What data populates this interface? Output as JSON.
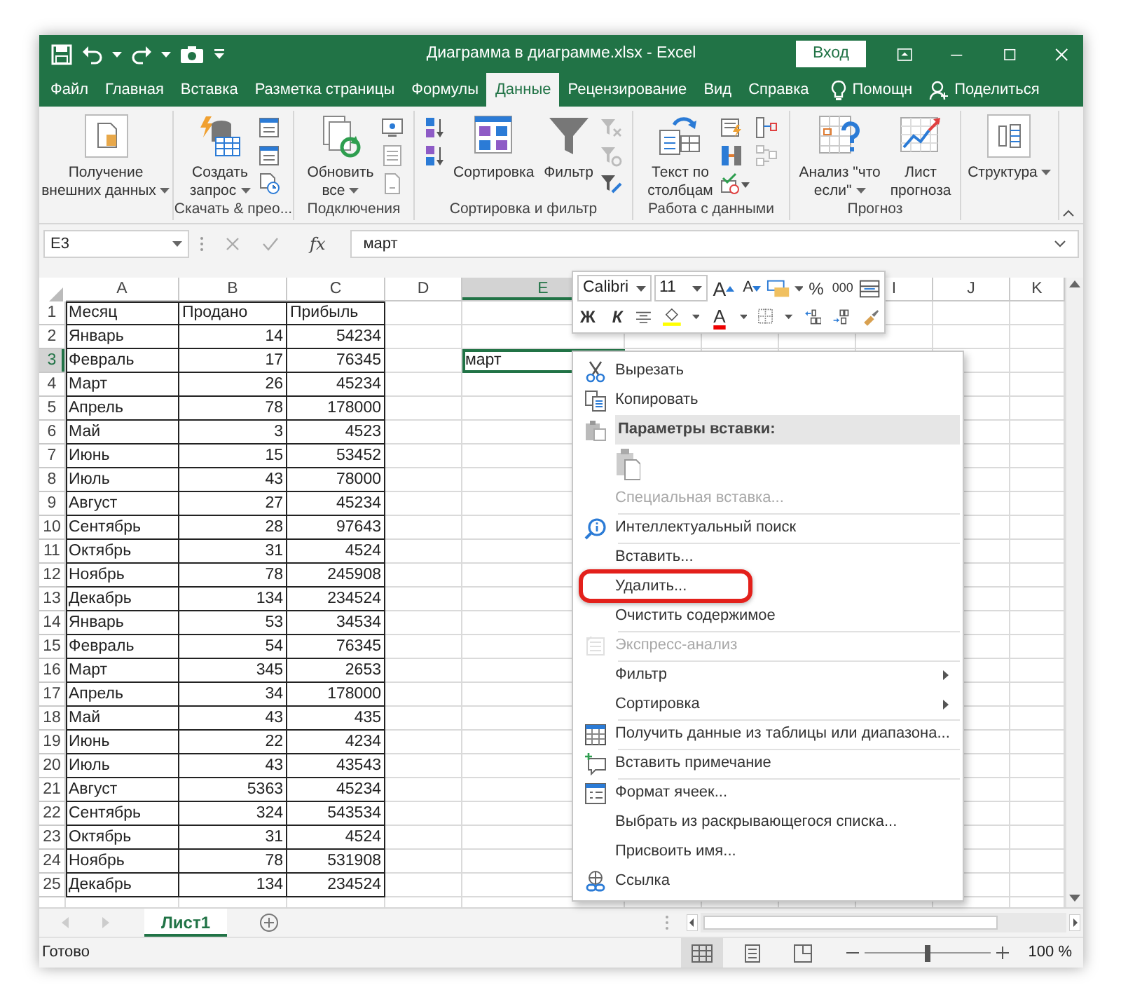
{
  "window": {
    "title": "Диаграмма в диаграмме.xlsx  -  Excel",
    "sign_in": "Вход"
  },
  "tabs": [
    {
      "label": "Файл",
      "selected": false
    },
    {
      "label": "Главная",
      "selected": false
    },
    {
      "label": "Вставка",
      "selected": false
    },
    {
      "label": "Разметка страницы",
      "selected": false
    },
    {
      "label": "Формулы",
      "selected": false
    },
    {
      "label": "Данные",
      "selected": true
    },
    {
      "label": "Рецензирование",
      "selected": false
    },
    {
      "label": "Вид",
      "selected": false
    },
    {
      "label": "Справка",
      "selected": false
    }
  ],
  "tell_me": "Помощн",
  "share": "Поделиться",
  "ribbon_groups": [
    {
      "buttons": [
        {
          "label": "Получение\nвнешних данных",
          "dropdown": true
        }
      ]
    },
    {
      "label": "Скачать & прео...",
      "buttons": [
        {
          "label": "Создать\nзапрос",
          "dropdown": true
        }
      ]
    },
    {
      "label": "Подключения",
      "buttons": [
        {
          "label": "Обновить\nвсе",
          "dropdown": true
        }
      ]
    },
    {
      "label": "Сортировка и фильтр",
      "buttons": [
        {
          "label": "Сортировка",
          "dropdown": false
        },
        {
          "label": "Фильтр",
          "dropdown": false
        }
      ]
    },
    {
      "label": "Работа с данными",
      "buttons": [
        {
          "label": "Текст по\nстолбцам",
          "dropdown": false
        }
      ]
    },
    {
      "label": "Прогноз",
      "buttons": [
        {
          "label": "Анализ \"что\nесли\"",
          "dropdown": true
        },
        {
          "label": "Лист\nпрогноза",
          "dropdown": false
        }
      ]
    },
    {
      "buttons": [
        {
          "label": "Структура",
          "dropdown": true
        }
      ]
    }
  ],
  "formula_bar": {
    "name_box": "E3",
    "function_label": "fx",
    "value": "март"
  },
  "sheet": {
    "columns": [
      {
        "label": "A",
        "selected": false
      },
      {
        "label": "B",
        "selected": false
      },
      {
        "label": "C",
        "selected": false
      },
      {
        "label": "D",
        "selected": false
      },
      {
        "label": "E",
        "selected": true
      },
      {
        "label": "I",
        "selected": false
      },
      {
        "label": "J",
        "selected": false
      },
      {
        "label": "K",
        "selected": false
      }
    ],
    "rows": [
      {
        "number": "1",
        "selected": false,
        "cells": [
          "Месяц",
          "Продано",
          "Прибыль"
        ]
      },
      {
        "number": "2",
        "selected": false,
        "cells": [
          "Январь",
          "14",
          "54234"
        ]
      },
      {
        "number": "3",
        "selected": true,
        "cells": [
          "Февраль",
          "17",
          "76345"
        ],
        "column_e": "март"
      },
      {
        "number": "4",
        "selected": false,
        "cells": [
          "Март",
          "26",
          "45234"
        ]
      },
      {
        "number": "5",
        "selected": false,
        "cells": [
          "Апрель",
          "78",
          "178000"
        ]
      },
      {
        "number": "6",
        "selected": false,
        "cells": [
          "Май",
          "3",
          "4523"
        ]
      },
      {
        "number": "7",
        "selected": false,
        "cells": [
          "Июнь",
          "15",
          "53452"
        ]
      },
      {
        "number": "8",
        "selected": false,
        "cells": [
          "Июль",
          "43",
          "78000"
        ]
      },
      {
        "number": "9",
        "selected": false,
        "cells": [
          "Август",
          "27",
          "45234"
        ]
      },
      {
        "number": "10",
        "selected": false,
        "cells": [
          "Сентябрь",
          "28",
          "97643"
        ]
      },
      {
        "number": "11",
        "selected": false,
        "cells": [
          "Октябрь",
          "31",
          "4524"
        ]
      },
      {
        "number": "12",
        "selected": false,
        "cells": [
          "Ноябрь",
          "78",
          "245908"
        ]
      },
      {
        "number": "13",
        "selected": false,
        "cells": [
          "Декабрь",
          "134",
          "234524"
        ]
      },
      {
        "number": "14",
        "selected": false,
        "cells": [
          "Январь",
          "53",
          "34534"
        ]
      },
      {
        "number": "15",
        "selected": false,
        "cells": [
          "Февраль",
          "54",
          "76345"
        ]
      },
      {
        "number": "16",
        "selected": false,
        "cells": [
          "Март",
          "345",
          "2653"
        ]
      },
      {
        "number": "17",
        "selected": false,
        "cells": [
          "Апрель",
          "34",
          "178000"
        ]
      },
      {
        "number": "18",
        "selected": false,
        "cells": [
          "Май",
          "43",
          "435"
        ]
      },
      {
        "number": "19",
        "selected": false,
        "cells": [
          "Июнь",
          "22",
          "4234"
        ]
      },
      {
        "number": "20",
        "selected": false,
        "cells": [
          "Июль",
          "43",
          "43543"
        ]
      },
      {
        "number": "21",
        "selected": false,
        "cells": [
          "Август",
          "5363",
          "45234"
        ]
      },
      {
        "number": "22",
        "selected": false,
        "cells": [
          "Сентябрь",
          "324",
          "543534"
        ]
      },
      {
        "number": "23",
        "selected": false,
        "cells": [
          "Октябрь",
          "31",
          "4524"
        ]
      },
      {
        "number": "24",
        "selected": false,
        "cells": [
          "Ноябрь",
          "78",
          "531908"
        ]
      },
      {
        "number": "25",
        "selected": false,
        "cells": [
          "Декабрь",
          "134",
          "234524"
        ]
      }
    ]
  },
  "mini_toolbar": {
    "font": "Calibri",
    "size": "11",
    "grow": "A",
    "shrink": "A",
    "percent": "%",
    "thousands": "000",
    "bold": "Ж",
    "italic": "К",
    "font_color": "A"
  },
  "context_menu": [
    {
      "kind": "item",
      "label": "Вырезать",
      "disabled": false,
      "submenu": false,
      "highlighted": false,
      "separated": false
    },
    {
      "kind": "item",
      "label": "Копировать",
      "disabled": false,
      "submenu": false,
      "highlighted": false,
      "separated": false
    },
    {
      "kind": "header",
      "label": "Параметры вставки:"
    },
    {
      "kind": "paste_options"
    },
    {
      "kind": "item",
      "label": "Специальная вставка...",
      "disabled": true,
      "submenu": false,
      "highlighted": false,
      "separated": false
    },
    {
      "kind": "item",
      "label": "Интеллектуальный поиск",
      "disabled": false,
      "submenu": false,
      "highlighted": false,
      "separated": true
    },
    {
      "kind": "item",
      "label": "Вставить...",
      "disabled": false,
      "submenu": false,
      "highlighted": false,
      "separated": true
    },
    {
      "kind": "item",
      "label": "Удалить...",
      "disabled": false,
      "submenu": false,
      "highlighted": true,
      "separated": false
    },
    {
      "kind": "item",
      "label": "Очистить содержимое",
      "disabled": false,
      "submenu": false,
      "highlighted": false,
      "separated": false
    },
    {
      "kind": "item",
      "label": "Экспресс-анализ",
      "disabled": true,
      "submenu": false,
      "highlighted": false,
      "separated": true
    },
    {
      "kind": "item",
      "label": "Фильтр",
      "disabled": false,
      "submenu": true,
      "highlighted": false,
      "separated": true
    },
    {
      "kind": "item",
      "label": "Сортировка",
      "disabled": false,
      "submenu": true,
      "highlighted": false,
      "separated": false
    },
    {
      "kind": "item",
      "label": "Получить данные из таблицы или диапазона...",
      "disabled": false,
      "submenu": false,
      "highlighted": false,
      "separated": true
    },
    {
      "kind": "item",
      "label": "Вставить примечание",
      "disabled": false,
      "submenu": false,
      "highlighted": false,
      "separated": true
    },
    {
      "kind": "item",
      "label": "Формат ячеек...",
      "disabled": false,
      "submenu": false,
      "highlighted": false,
      "separated": true
    },
    {
      "kind": "item",
      "label": "Выбрать из раскрывающегося списка...",
      "disabled": false,
      "submenu": false,
      "highlighted": false,
      "separated": false
    },
    {
      "kind": "item",
      "label": "Присвоить имя...",
      "disabled": false,
      "submenu": false,
      "highlighted": false,
      "separated": false
    },
    {
      "kind": "item",
      "label": "Ссылка",
      "disabled": false,
      "submenu": false,
      "highlighted": false,
      "separated": false
    }
  ],
  "sheet_tabs": [
    {
      "label": "Лист1",
      "selected": true
    }
  ],
  "status_bar": {
    "status": "Готово",
    "views": [
      {
        "selected": true
      },
      {
        "selected": false
      },
      {
        "selected": false
      }
    ],
    "zoom": {
      "level": 0.5,
      "reading": "100 %"
    }
  }
}
